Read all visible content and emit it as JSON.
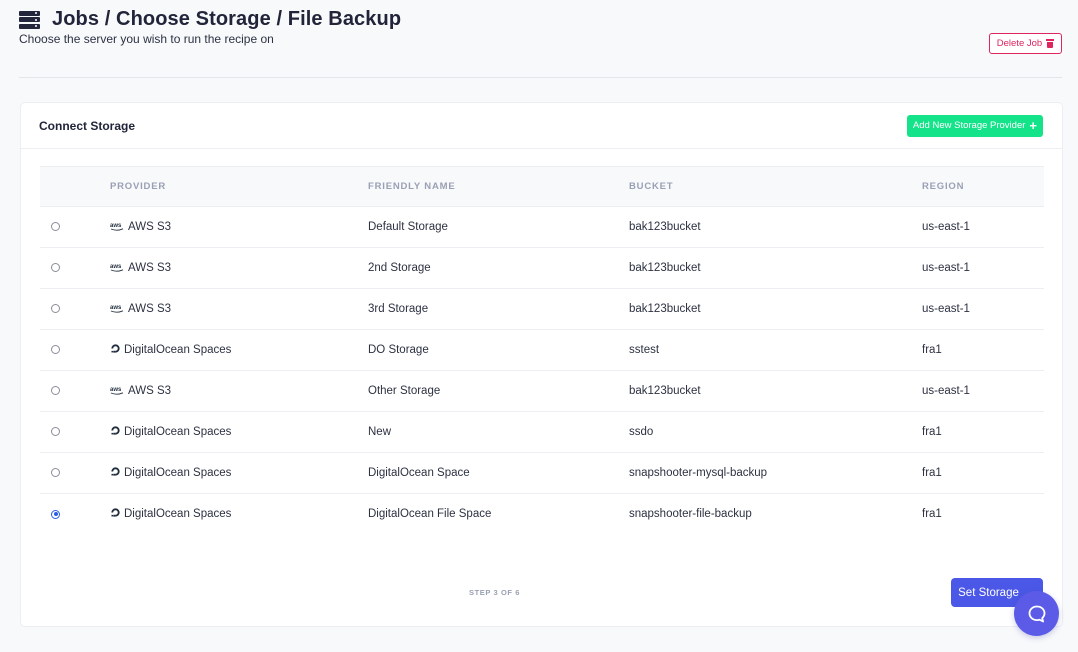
{
  "header": {
    "title": "Jobs / Choose Storage / File Backup",
    "subtitle": "Choose the server you wish to run the recipe on",
    "delete_label": "Delete Job"
  },
  "card": {
    "title": "Connect Storage",
    "add_label": "Add New Storage Provider",
    "columns": [
      "Provider",
      "Friendly Name",
      "Bucket",
      "Region"
    ],
    "rows": [
      {
        "provider": "AWS S3",
        "provider_icon": "aws-icon",
        "name": "Default Storage",
        "bucket": "bak123bucket",
        "region": "us-east-1",
        "selected": false
      },
      {
        "provider": "AWS S3",
        "provider_icon": "aws-icon",
        "name": "2nd Storage",
        "bucket": "bak123bucket",
        "region": "us-east-1",
        "selected": false
      },
      {
        "provider": "AWS S3",
        "provider_icon": "aws-icon",
        "name": "3rd Storage",
        "bucket": "bak123bucket",
        "region": "us-east-1",
        "selected": false
      },
      {
        "provider": "DigitalOcean Spaces",
        "provider_icon": "digitalocean-icon",
        "name": "DO Storage",
        "bucket": "sstest",
        "region": "fra1",
        "selected": false
      },
      {
        "provider": "AWS S3",
        "provider_icon": "aws-icon",
        "name": "Other Storage",
        "bucket": "bak123bucket",
        "region": "us-east-1",
        "selected": false
      },
      {
        "provider": "DigitalOcean Spaces",
        "provider_icon": "digitalocean-icon",
        "name": "New",
        "bucket": "ssdo",
        "region": "fra1",
        "selected": false
      },
      {
        "provider": "DigitalOcean Spaces",
        "provider_icon": "digitalocean-icon",
        "name": "DigitalOcean Space",
        "bucket": "snapshooter-mysql-backup",
        "region": "fra1",
        "selected": false
      },
      {
        "provider": "DigitalOcean Spaces",
        "provider_icon": "digitalocean-icon",
        "name": "DigitalOcean File Space",
        "bucket": "snapshooter-file-backup",
        "region": "fra1",
        "selected": true
      }
    ],
    "step_label": "STEP 3 OF 6",
    "set_label": "Set Storage"
  },
  "colors": {
    "accent": "#4b57e6",
    "add_button": "#14e38a",
    "danger": "#e0245e",
    "chat": "#5b5be8"
  }
}
